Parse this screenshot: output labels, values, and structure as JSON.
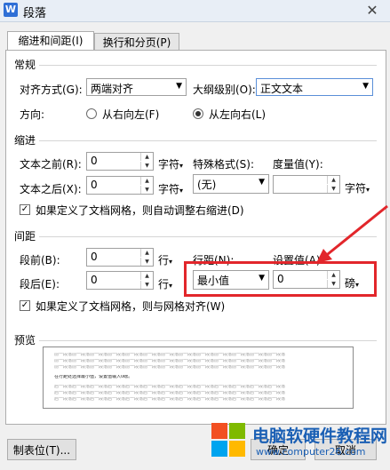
{
  "window": {
    "title": "段落",
    "app_icon_letter": "W",
    "close": "✕"
  },
  "tabs": [
    {
      "label": "缩进和间距(I)",
      "active": true
    },
    {
      "label": "换行和分页(P)",
      "active": false
    }
  ],
  "general": {
    "section": "常规",
    "alignment_label": "对齐方式(G):",
    "alignment_value": "两端对齐",
    "outline_label": "大纲级别(O):",
    "outline_value": "正文文本",
    "direction_label": "方向:",
    "rtl_label": "从右向左(F)",
    "ltr_label": "从左向右(L)",
    "direction_selected": "ltr"
  },
  "indent": {
    "section": "缩进",
    "before_label": "文本之前(R):",
    "before_value": "0",
    "before_unit": "字符",
    "after_label": "文本之后(X):",
    "after_value": "0",
    "after_unit": "字符",
    "special_label": "特殊格式(S):",
    "special_value": "(无)",
    "measure_label": "度量值(Y):",
    "measure_value": "",
    "measure_unit": "字符",
    "grid_check_label": "如果定义了文档网格，则自动调整右缩进(D)",
    "grid_checked": true
  },
  "spacing": {
    "section": "间距",
    "before_label": "段前(B):",
    "before_value": "0",
    "before_unit": "行",
    "after_label": "段后(E):",
    "after_value": "0",
    "after_unit": "行",
    "line_label": "行距(N):",
    "line_value": "最小值",
    "setting_label": "设置值(A):",
    "setting_value": "0",
    "setting_unit": "磅",
    "grid_check_label": "如果定义了文档网格，则与网格对齐(W)",
    "grid_checked": true
  },
  "preview": {
    "section": "预览",
    "prev_text": "前一段落前一段落前一段落前一段落前一段落前一段落前一段落前一段落前一段落前一段落前一段落前一段落前一段落",
    "current_text": "在行距处选择最小值，设置值输入0磅。",
    "next_text": "后一段落后一段落后一段落后一段落后一段落后一段落后一段落后一段落后一段落后一段落后一段落后一段落后一段落"
  },
  "buttons": {
    "tabs": "制表位(T)...",
    "ok": "确定",
    "cancel": "取消"
  },
  "watermark": {
    "text": "电脑软硬件教程网",
    "url": "www.computer26.com"
  },
  "colors": {
    "highlight": "#e2262b",
    "arrow": "#e2262b",
    "watermark_blue": "#1a5fb4"
  }
}
